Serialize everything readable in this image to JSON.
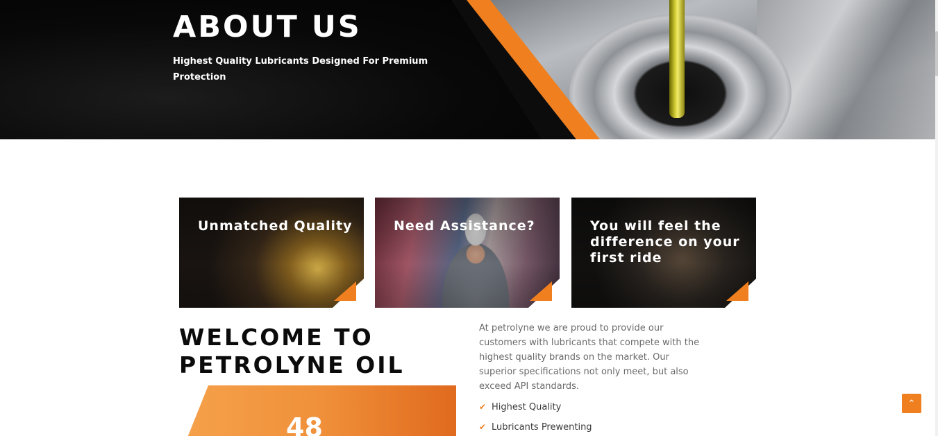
{
  "hero": {
    "title": "ABOUT US",
    "subtitle": "Highest Quality Lubricants Designed For Premium Protection"
  },
  "cards": [
    {
      "title": "Unmatched Quality"
    },
    {
      "title": "Need Assistance?"
    },
    {
      "title": "You will feel the difference on your first ride"
    }
  ],
  "welcome": {
    "heading_line1": "WELCOME TO",
    "heading_line2": "PETROLYNE OIL",
    "stat_value": "48"
  },
  "about": {
    "paragraph": "At petrolyne we are proud to provide our customers with lubricants that compete with the highest quality brands on the market. Our superior specifications not only meet, but also exceed API standards.",
    "features": [
      "Highest Quality",
      "Lubricants Prewenting"
    ]
  },
  "colors": {
    "accent": "#f07f1f",
    "hero_bg": "#050505"
  },
  "icons": {
    "check": "check-icon",
    "scroll_top": "chevron-up-icon"
  }
}
